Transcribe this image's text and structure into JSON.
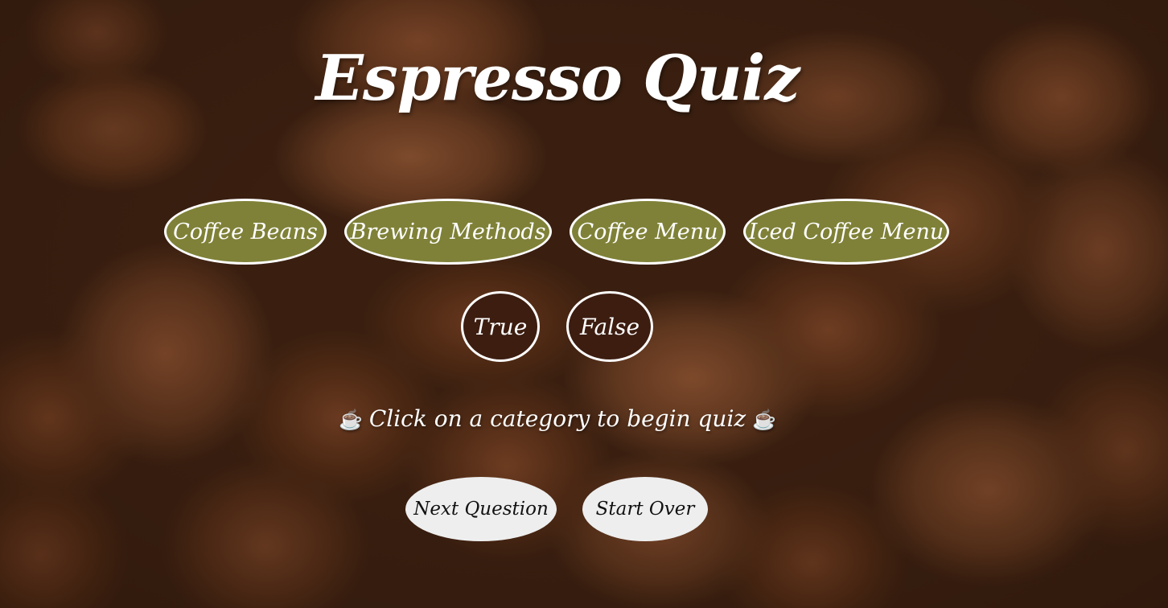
{
  "page": {
    "title": "Espresso Quiz"
  },
  "categories": [
    {
      "label": "Coffee Beans"
    },
    {
      "label": "Brewing Methods"
    },
    {
      "label": "Coffee Menu"
    },
    {
      "label": "Iced Coffee Menu"
    }
  ],
  "answers": {
    "true_label": "True",
    "false_label": "False"
  },
  "message": {
    "text": "Click on a category to begin quiz",
    "icon_left": "☕",
    "icon_right": "☕",
    "icon_name": "coffee-cup-icon"
  },
  "controls": {
    "next_label": "Next Question",
    "start_over_label": "Start Over"
  },
  "colors": {
    "category_button": "#7f8138",
    "answer_button": "#3c1d10",
    "control_button": "#eeeeee",
    "text": "#ffffff"
  }
}
